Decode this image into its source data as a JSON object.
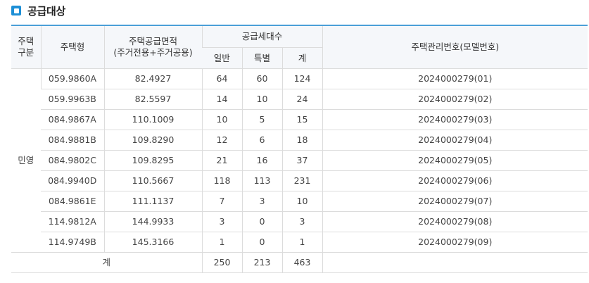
{
  "section": {
    "title": "공급대상",
    "icon": "square-bullet-icon",
    "accent_color": "#1e8fd6"
  },
  "table": {
    "headers": {
      "housing_category": "주택\n구분",
      "housing_type": "주택형",
      "supply_area": "주택공급면적\n(주거전용+주거공용)",
      "supply_units": "공급세대수",
      "general": "일반",
      "special": "특별",
      "total": "계",
      "management_no": "주택관리번호(모델번호)"
    },
    "group_label": "민영",
    "rows": [
      {
        "type": "059.9860A",
        "area": "82.4927",
        "general": "64",
        "special": "60",
        "total": "124",
        "mgmt": "2024000279(01)"
      },
      {
        "type": "059.9963B",
        "area": "82.5597",
        "general": "14",
        "special": "10",
        "total": "24",
        "mgmt": "2024000279(02)"
      },
      {
        "type": "084.9867A",
        "area": "110.1009",
        "general": "10",
        "special": "5",
        "total": "15",
        "mgmt": "2024000279(03)"
      },
      {
        "type": "084.9881B",
        "area": "109.8290",
        "general": "12",
        "special": "6",
        "total": "18",
        "mgmt": "2024000279(04)"
      },
      {
        "type": "084.9802C",
        "area": "109.8295",
        "general": "21",
        "special": "16",
        "total": "37",
        "mgmt": "2024000279(05)"
      },
      {
        "type": "084.9940D",
        "area": "110.5667",
        "general": "118",
        "special": "113",
        "total": "231",
        "mgmt": "2024000279(06)"
      },
      {
        "type": "084.9861E",
        "area": "111.1137",
        "general": "7",
        "special": "3",
        "total": "10",
        "mgmt": "2024000279(07)"
      },
      {
        "type": "114.9812A",
        "area": "144.9933",
        "general": "3",
        "special": "0",
        "total": "3",
        "mgmt": "2024000279(08)"
      },
      {
        "type": "114.9749B",
        "area": "145.3166",
        "general": "1",
        "special": "0",
        "total": "1",
        "mgmt": "2024000279(09)"
      }
    ],
    "totals": {
      "label": "계",
      "general": "250",
      "special": "213",
      "total": "463",
      "mgmt": ""
    }
  }
}
